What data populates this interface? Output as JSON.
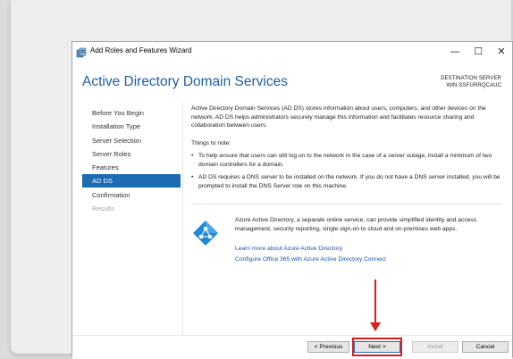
{
  "window": {
    "title": "Add Roles and Features Wizard",
    "minimize_glyph": "—",
    "maximize_glyph": "☐",
    "close_glyph": "✕"
  },
  "header": {
    "title": "Active Directory Domain Services",
    "destination_label": "DESTINATION SERVER",
    "destination_server": "WIN-SSFURRQCAUC"
  },
  "nav": {
    "items": [
      {
        "label": "Before You Begin",
        "state": "normal"
      },
      {
        "label": "Installation Type",
        "state": "normal"
      },
      {
        "label": "Server Selection",
        "state": "normal"
      },
      {
        "label": "Server Roles",
        "state": "normal"
      },
      {
        "label": "Features",
        "state": "normal"
      },
      {
        "label": "AD DS",
        "state": "active"
      },
      {
        "label": "Confirmation",
        "state": "normal"
      },
      {
        "label": "Results",
        "state": "disabled"
      }
    ]
  },
  "content": {
    "intro": "Active Directory Domain Services (AD DS) stores information about users, computers, and other devices on the network.  AD DS helps administrators securely manage this information and facilitates resource sharing and collaboration between users.",
    "notes_heading": "Things to note:",
    "bullets": [
      "To help ensure that users can still log on to the network in the case of a server outage, install a minimum of two domain controllers for a domain.",
      "AD DS requires a DNS server to be installed on the network.  If you do not have a DNS server installed, you will be prompted to install the DNS Server role on this machine."
    ],
    "bullet_glyph": "•",
    "azure_text": "Azure Active Directory, a separate online service, can provide simplified identity and access management, security reporting, single sign-on to cloud and on-premises web apps.",
    "links": [
      "Learn more about Azure Active Directory",
      "Configure Office 365 with Azure Active Directory Connect"
    ]
  },
  "footer": {
    "previous": "< Previous",
    "next": "Next >",
    "install": "Install",
    "cancel": "Cancel"
  },
  "colors": {
    "accent": "#1c6cb4",
    "title_blue": "#1e5ea8",
    "link": "#1a56b0",
    "annotation_red": "#e01b1b"
  }
}
